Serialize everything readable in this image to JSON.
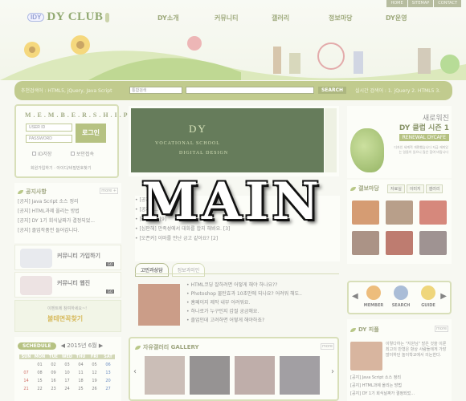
{
  "top_links": [
    "HOME",
    "SITEMAP",
    "CONTACT"
  ],
  "logo": {
    "badge": "IDY",
    "text": "DY CLUB"
  },
  "main_nav": [
    "DY소개",
    "커뮤니티",
    "갤러리",
    "정보마당",
    "DY운영"
  ],
  "search": {
    "label": "추천검색어 : HTML5, jQuery, Java Script",
    "select_value": "통합검색",
    "button": "SEARCH",
    "realtime": "실시간 검색어 : 1. jQuery 2. HTML5 3."
  },
  "membership": {
    "title": "M.E.M.B.E.R.S.H.I.P",
    "user_id_placeholder": "USER ID",
    "password_placeholder": "PASSWORD",
    "login": "로그인",
    "checks": [
      "ID저장",
      "보안접속"
    ],
    "links": "회원가입하기 · 아이디/비밀번호찾기"
  },
  "banner": {
    "title": "DY",
    "line1": "VOCATIONAL SCHOOL",
    "line2": "DIGITAL DESIGN"
  },
  "right_ad": {
    "line1": "새로워진",
    "line2": "DY 클럽 시즌 1",
    "tag": "RENEWAL DYCAFE",
    "desc": "디자인 세계적 개편했습니다 지금 재미있는 일들이 있으니 많은 참여 바랍니다"
  },
  "notice": {
    "title": "공지사항",
    "more": "more +",
    "items": [
      "[공지] Java Script 소스 정리",
      "[공지] HTML과제 올리는 방법",
      "[공지] DY 1기 회식날짜가 결정되었...",
      "[공지] 졸업작품전 들어갑니다."
    ]
  },
  "center_list": {
    "items": [
      "[공지] ... [4]",
      "[공지] ... [2]",
      "[공지] ... [9]",
      "[심판해] 만족성에서 대화를 합지 해봐요. [3]",
      "[오픈커] 이마를 만난 긍고 같아요? [2]"
    ]
  },
  "gallery_right": {
    "title": "갤보마당",
    "tabs": [
      "자료실",
      "이미지",
      "갤러리"
    ],
    "more": "more"
  },
  "community": [
    {
      "label": "커뮤니티 가입하기",
      "go": "GO"
    },
    {
      "label": "커뮤니티 웹진",
      "go": "GO"
    }
  ],
  "event": {
    "line1": "이벤트에 참여하세요~!",
    "line2": "불테면꼭찾기"
  },
  "qa_tabs": [
    "고민과상담",
    "정보과미인"
  ],
  "qa_list": [
    "HTML코딩 잘하려면 어떻게 해야 하나요??",
    "Photoshop 물탄효과 10초만에 되나요? 어려워 해도..",
    "홈페이지 제작 내부 어려워요.",
    "하나로가 누구인지 갑절 궁금해요.",
    "졸업인데 고려하면 어떻게 해야하죠?"
  ],
  "free_gallery": {
    "title": "자유갤러리 GALLERY",
    "more": "more"
  },
  "icon_row": [
    {
      "label": "MEMBER",
      "icon": "member-icon"
    },
    {
      "label": "SEARCH",
      "icon": "search-icon"
    },
    {
      "label": "GUIDE",
      "icon": "guide-icon"
    }
  ],
  "interview": {
    "title": "DY 피플",
    "more": "more",
    "intro": "이렇다하는 \"지원님\" 많은 것을 이룬 최고의 반형은 항상 사람들에게 가장 많이하던 놀이학교에서 의논한다.",
    "items": [
      "[공지] Java Script 소스 정리",
      "[공지] HTML과제 올리는 방법",
      "[공지] DY 1기 회식날짜가 결정되었..."
    ]
  },
  "calendar": {
    "label": "SCHEDULE",
    "month": "◀ 2015년 6월 ▶",
    "days": [
      "SUN",
      "MON",
      "TUE",
      "WED",
      "THU",
      "FRI",
      "SAT"
    ],
    "rows": [
      [
        "",
        "01",
        "02",
        "03",
        "04",
        "05",
        "06"
      ],
      [
        "07",
        "08",
        "09",
        "10",
        "11",
        "12",
        "13"
      ],
      [
        "14",
        "15",
        "16",
        "17",
        "18",
        "19",
        "20"
      ],
      [
        "21",
        "22",
        "23",
        "24",
        "25",
        "26",
        "27"
      ]
    ]
  },
  "overlay_title": "MAIN",
  "colors": {
    "accent": "#a9b763",
    "dark_green": "#2c4a1c",
    "text": "#555555"
  }
}
